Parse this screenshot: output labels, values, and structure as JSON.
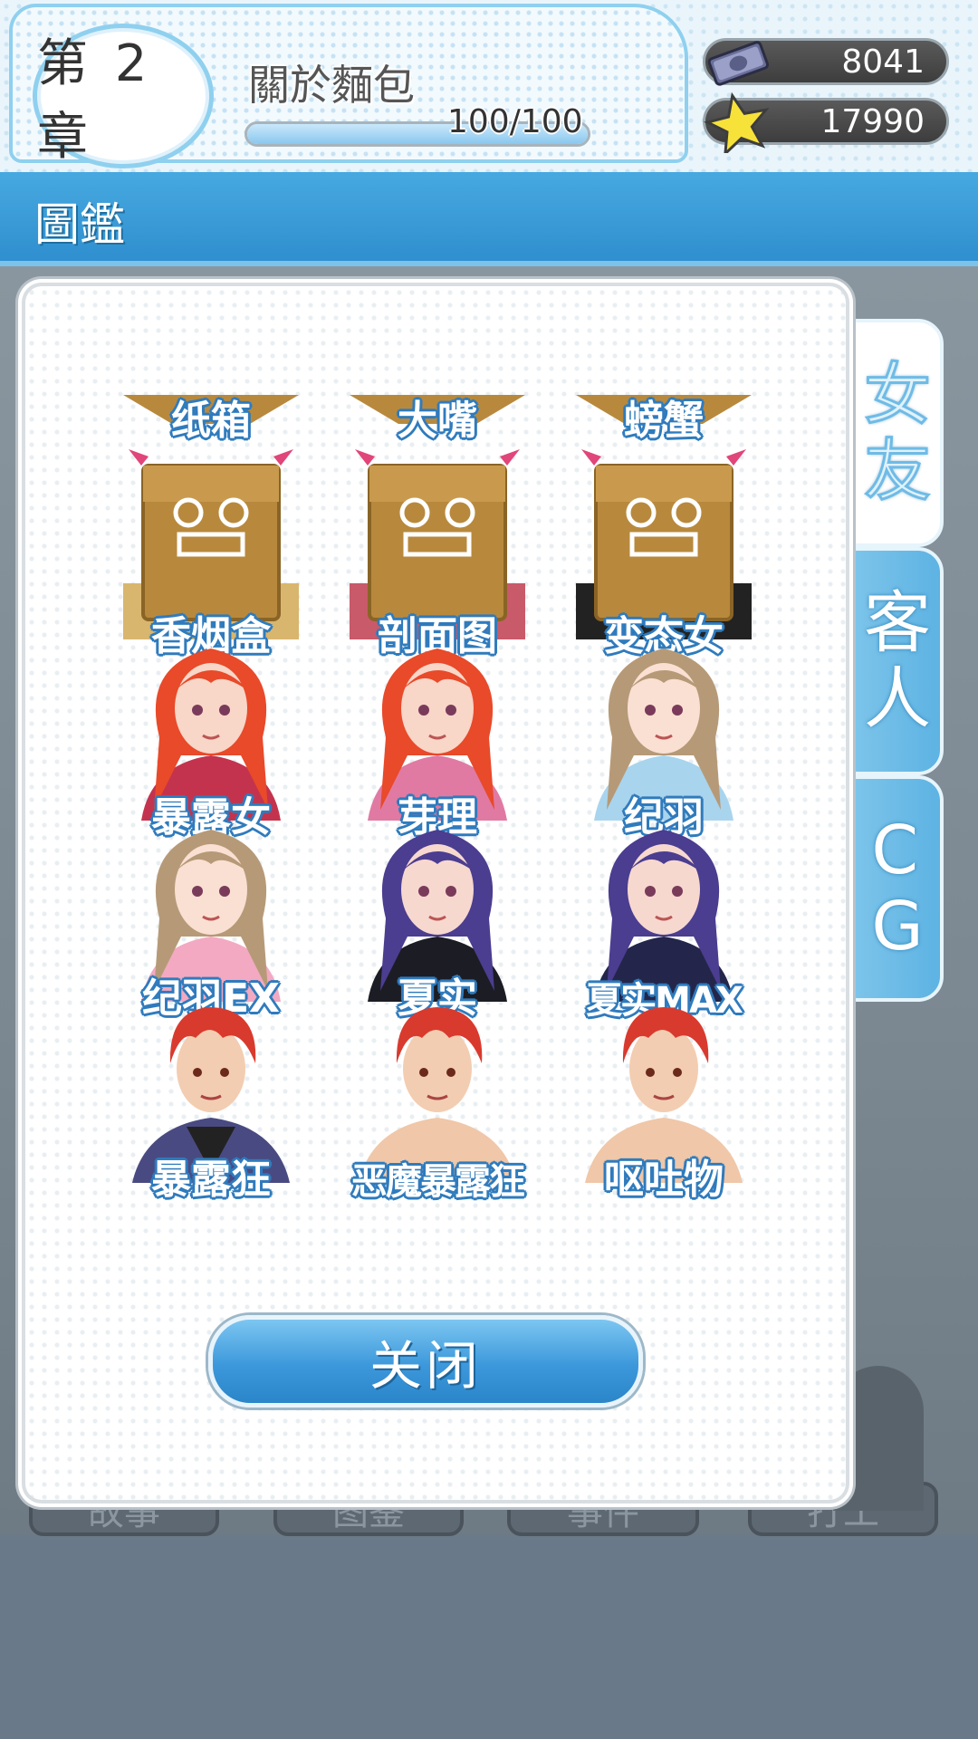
{
  "header": {
    "chapter": "第 2 章",
    "chapter_title": "關於麵包",
    "progress_text": "100/100",
    "progress_fraction": 1.0,
    "money": "8041",
    "stars": "17990",
    "money_icon": "cash-bundle-icon",
    "star_icon": "star-icon"
  },
  "tab_bar": {
    "title": "圖鑑"
  },
  "side_tabs": [
    {
      "label": "女\n友",
      "active": true
    },
    {
      "label": "客\n人",
      "active": false
    },
    {
      "label": "C\nG",
      "active": false
    }
  ],
  "gallery": {
    "rows": [
      [
        "纸箱",
        "大嘴",
        "螃蟹"
      ],
      [
        "香烟盒",
        "剖面图",
        "变态女"
      ],
      [
        "暴露女",
        "芽理",
        "纪羽"
      ],
      [
        "纪羽EX",
        "夏实",
        "夏实MAX"
      ],
      [
        "暴露狂",
        "恶魔暴露狂",
        "呕吐物"
      ]
    ]
  },
  "close_button": "关闭",
  "background_buttons": [
    "故事",
    "图鉴",
    "事件",
    "打工"
  ],
  "colors": {
    "accent_blue": "#3f9fdc",
    "label_outline": "#2f7bbd"
  }
}
